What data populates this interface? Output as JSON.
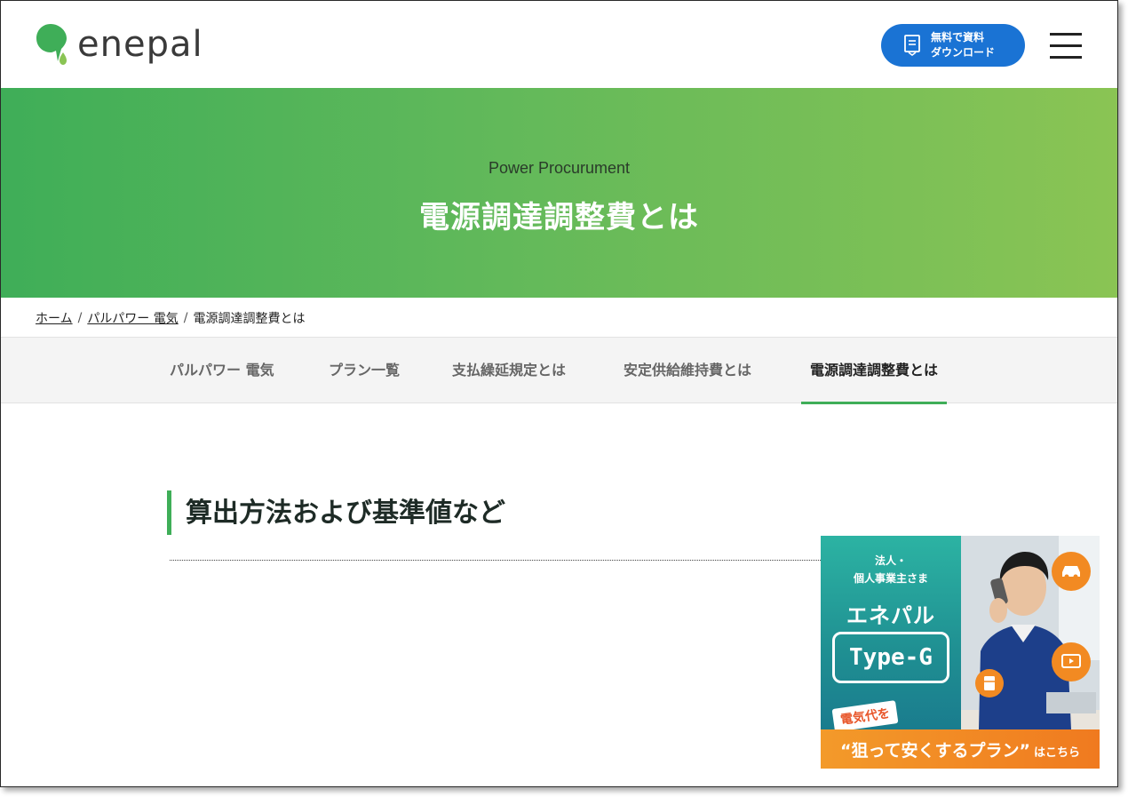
{
  "header": {
    "logo_text": "enepal",
    "download_button": {
      "line1": "無料で資料",
      "line2": "ダウンロード"
    }
  },
  "hero": {
    "subtitle": "Power Procurument",
    "title": "電源調達調整費とは"
  },
  "breadcrumb": {
    "items": [
      "ホーム",
      "パルパワー 電気",
      "電源調達調整費とは"
    ],
    "separator": "/"
  },
  "subnav": {
    "items": [
      {
        "label": "パルパワー 電気"
      },
      {
        "label": "プラン一覧"
      },
      {
        "label": "支払繰延規定とは"
      },
      {
        "label": "安定供給維持費とは"
      },
      {
        "label": "電源調達調整費とは",
        "active": true
      }
    ]
  },
  "content": {
    "section_heading": "算出方法および基準値など"
  },
  "ad": {
    "kicker_line1": "法人・",
    "kicker_line2": "個人事業主さま",
    "brand": "エネパル",
    "plan": "Type-G",
    "tag": "電気代を",
    "bottom_main": "“狙って安くするプラン”",
    "bottom_tail": "はこちら"
  },
  "colors": {
    "brand_green": "#3fae58",
    "accent_blue": "#1a73d4",
    "ad_orange": "#f28a22",
    "ad_teal": "#1f8f92"
  }
}
